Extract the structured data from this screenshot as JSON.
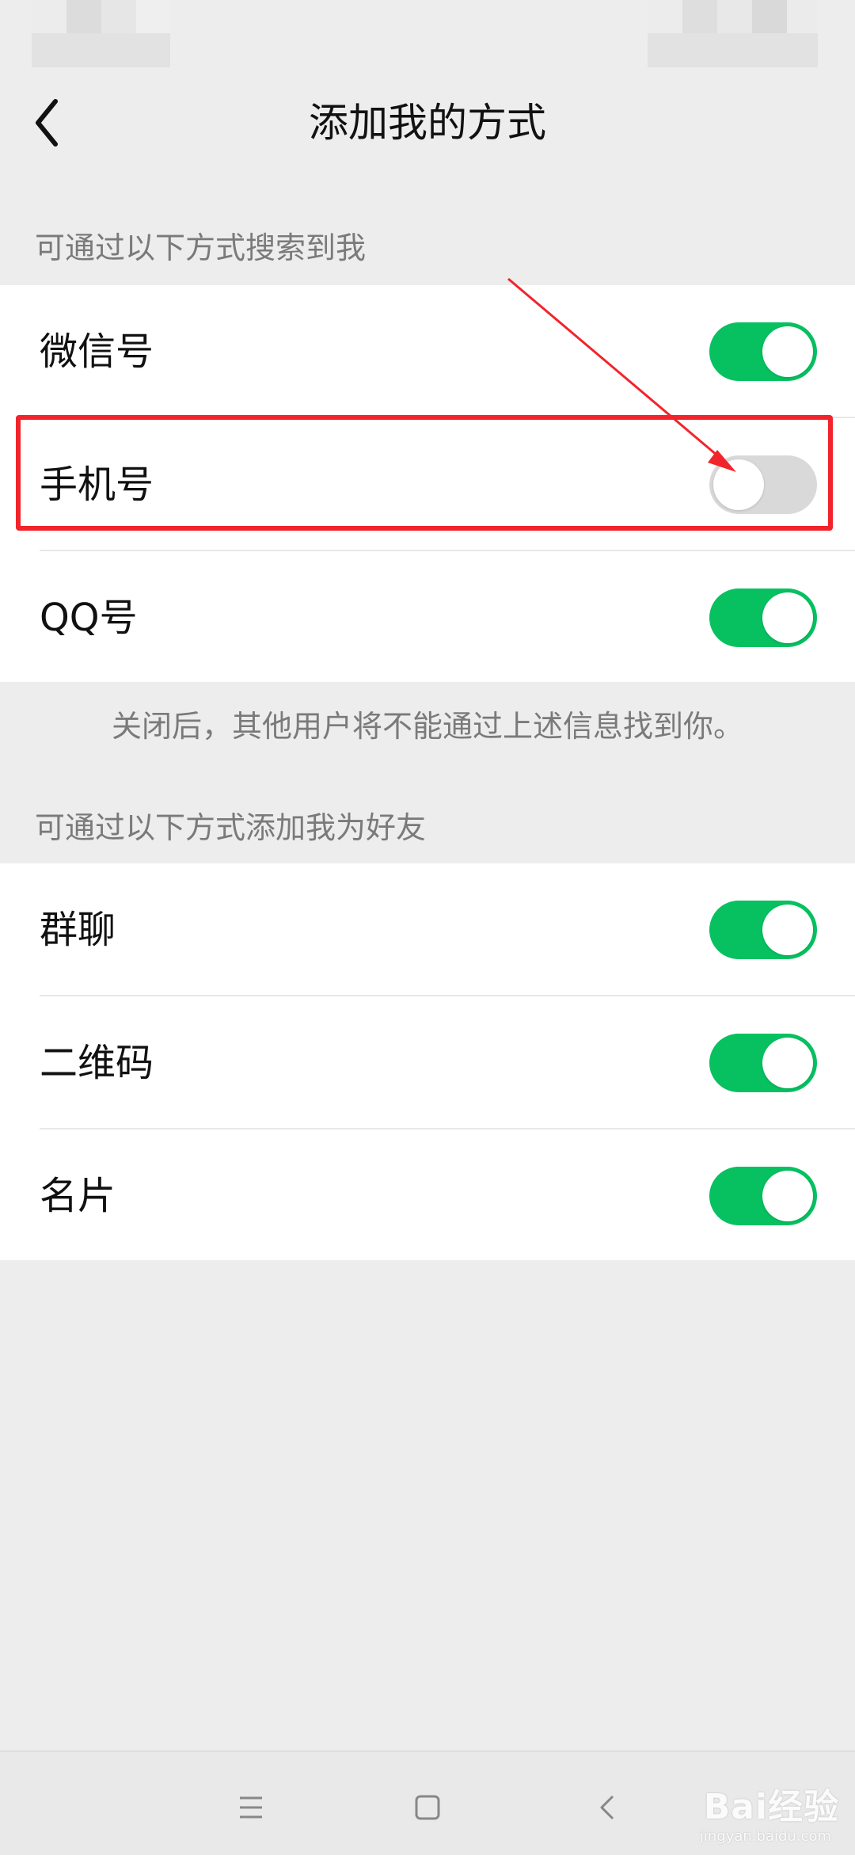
{
  "header": {
    "title": "添加我的方式",
    "back_icon": "chevron-left-icon"
  },
  "search_section": {
    "header": "可通过以下方式搜索到我",
    "items": [
      {
        "label": "微信号",
        "enabled": true
      },
      {
        "label": "手机号",
        "enabled": false
      },
      {
        "label": "QQ号",
        "enabled": true
      }
    ],
    "footnote": "关闭后，其他用户将不能通过上述信息找到你。"
  },
  "friend_section": {
    "header": "可通过以下方式添加我为好友",
    "items": [
      {
        "label": "群聊",
        "enabled": true
      },
      {
        "label": "二维码",
        "enabled": true
      },
      {
        "label": "名片",
        "enabled": true
      }
    ]
  },
  "colors": {
    "toggle_on": "#07c160",
    "toggle_off": "#d9d9d9",
    "annotation": "#f2242b",
    "background": "#ededed"
  },
  "nav_bar": {
    "icons": [
      "menu-icon",
      "home-square-icon",
      "back-triangle-icon"
    ]
  },
  "watermark": {
    "text": "Bai经验",
    "sub": "jingyan.baidu.com"
  }
}
